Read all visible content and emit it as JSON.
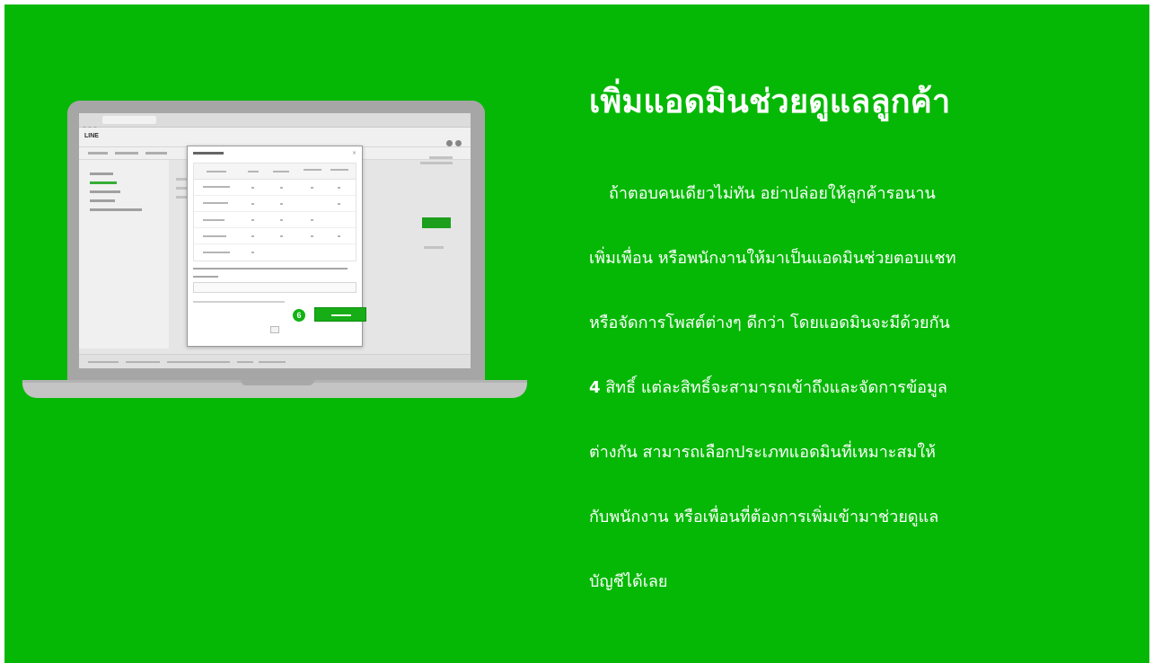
{
  "headline": "เพิ่มแอดมินช่วยดูแลลูกค้า",
  "body": {
    "line1": "ถ้าตอบคนเดียวไม่ทัน อย่าปล่อยให้ลูกค้ารอนาน",
    "line2": "เพิ่มเพื่อน หรือพนักงานให้มาเป็นแอดมินช่วยตอบแชท",
    "line3": "หรือจัดการโพสต์ต่างๆ ดีกว่า โดยแอดมินจะมีด้วยกัน",
    "line4_number": "4",
    "line4_rest": " สิทธิ์ แต่ละสิทธิ์จะสามารถเข้าถึงและจัดการข้อมูล",
    "line5": "ต่างกัน สามารถเลือกประเภทแอดมินที่เหมาะสมให้",
    "line6": "กับพนักงาน หรือเพื่อนที่ต้องการเพิ่มเข้ามาช่วยดูแล",
    "line7": "บัญชีได้เลย"
  },
  "laptop": {
    "screen_logo": "LINE",
    "callout_number": "6",
    "modal_close": "×"
  },
  "colors": {
    "background": "#06b806",
    "accent": "#16ad16",
    "text": "#ffffff"
  }
}
